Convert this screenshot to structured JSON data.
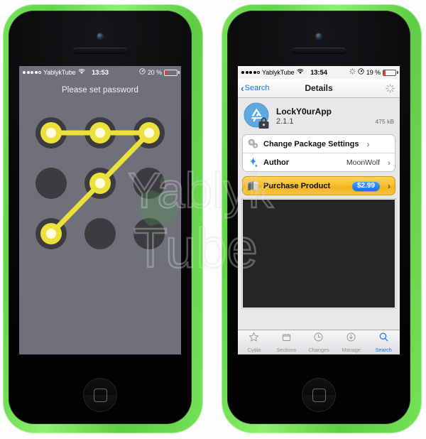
{
  "left_phone": {
    "device": "iPhone 5c green",
    "status_bar": {
      "carrier": "YablykTube",
      "signal_dots": 5,
      "signal_filled": 4,
      "wifi": "wifi-icon",
      "time": "13:53",
      "location": "location-icon",
      "battery_percent": "20 %",
      "battery_level": 20,
      "battery_color": "#e8392f"
    },
    "screen": {
      "title": "Please set password",
      "background": "#6f7079",
      "pattern": {
        "rows": 3,
        "cols": 3,
        "sequence": [
          1,
          2,
          3,
          5,
          7
        ],
        "line_color": "#ece13c",
        "dot_active_color": "#fdf7a0",
        "dot_inactive_color": "#3a3a3d"
      }
    }
  },
  "right_phone": {
    "device": "iPhone 5c green",
    "status_bar": {
      "carrier": "YablykTube",
      "signal_dots": 5,
      "signal_filled": 4,
      "wifi": "wifi-icon",
      "time": "13:54",
      "spinner": "activity-spinner-icon",
      "location": "location-icon",
      "battery_percent": "19 %",
      "battery_level": 19,
      "battery_color": "#e8392f"
    },
    "navbar": {
      "back_label": "Search",
      "title": "Details",
      "spinner": "activity-spinner-icon",
      "tint": "#1476f2"
    },
    "app": {
      "icon": "app-store-lock-icon",
      "name": "LockY0urApp",
      "version": "2.1.1",
      "size": "475 kB"
    },
    "rows": [
      {
        "icon": "gears-icon",
        "label": "Change Package Settings",
        "value": "",
        "chevron": "›"
      },
      {
        "icon": "sparkle-icon",
        "label": "Author",
        "value": "MoonWolf",
        "chevron": "›"
      }
    ],
    "purchase": {
      "icon": "package-book-icon",
      "label": "Purchase Product",
      "price": "$2.99",
      "chevron": "›",
      "accent": "#f3b31c",
      "price_bg": "#1570ef"
    },
    "tabs": [
      {
        "label": "Cydia",
        "icon": "star-icon",
        "active": false
      },
      {
        "label": "Sections",
        "icon": "box-icon",
        "active": false
      },
      {
        "label": "Changes",
        "icon": "clock-icon",
        "active": false
      },
      {
        "label": "Manage",
        "icon": "download-icon",
        "active": false
      },
      {
        "label": "Search",
        "icon": "search-icon",
        "active": true
      }
    ]
  },
  "watermark": {
    "line1": "Yablyk",
    "line2": "Tube",
    "logo": "apple-logo",
    "logo_color": "#4f9a52"
  }
}
